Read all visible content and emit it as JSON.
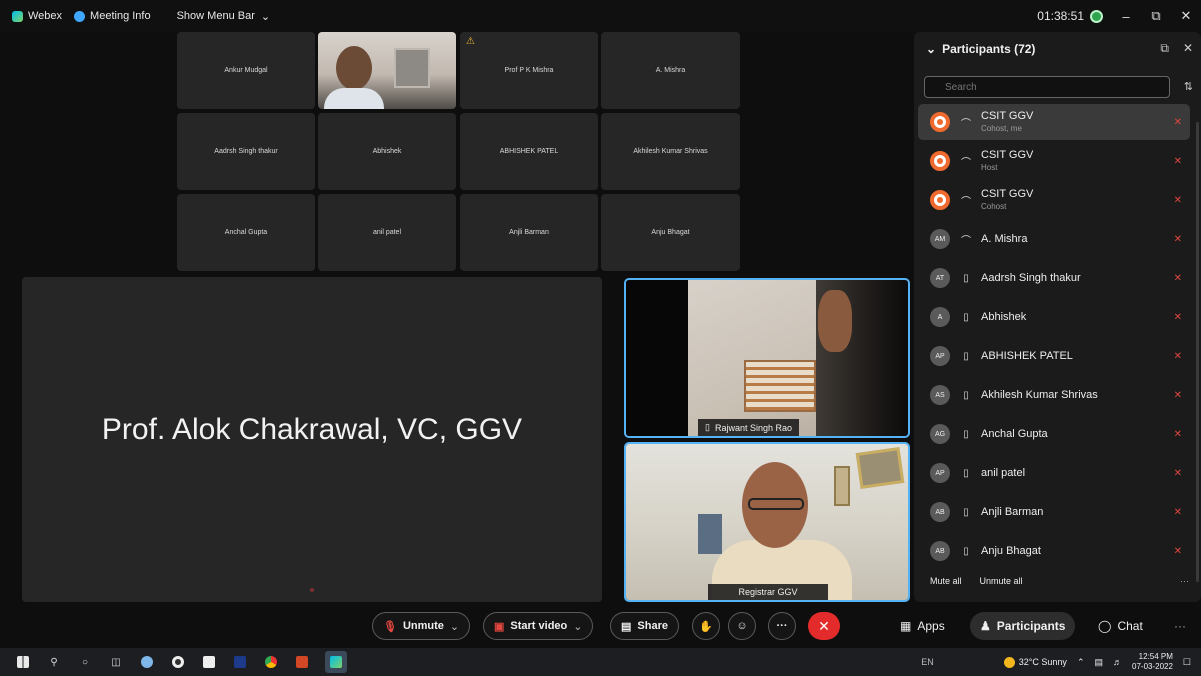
{
  "topbar": {
    "app_name": "Webex",
    "meeting_info": "Meeting Info",
    "show_menu_bar": "Show Menu Bar",
    "timer": "01:38:51"
  },
  "grid_tiles": [
    {
      "label": "Ankur Mudgal"
    },
    {
      "label": ""
    },
    {
      "label": "Prof P K Mishra"
    },
    {
      "label": "A. Mishra"
    },
    {
      "label": "Aadrsh Singh thakur"
    },
    {
      "label": "Abhishek"
    },
    {
      "label": "ABHISHEK PATEL"
    },
    {
      "label": "Akhilesh Kumar Shrivas"
    },
    {
      "label": "Anchal Gupta"
    },
    {
      "label": "anil patel"
    },
    {
      "label": "Anjli Barman"
    },
    {
      "label": "Anju Bhagat"
    }
  ],
  "stage": {
    "name": "Prof. Alok Chakrawal, VC, GGV"
  },
  "videos": [
    {
      "label": "Rajwant Singh Rao"
    },
    {
      "label": "Registrar GGV"
    }
  ],
  "participants": {
    "title": "Participants (72)",
    "search_placeholder": "Search",
    "list": [
      {
        "initials": "",
        "name": "CSIT GGV",
        "role": "Cohost, me",
        "device": "headset-icon"
      },
      {
        "initials": "",
        "name": "CSIT GGV",
        "role": "Host",
        "device": "headset-icon"
      },
      {
        "initials": "",
        "name": "CSIT GGV",
        "role": "Cohost",
        "device": "headset-icon"
      },
      {
        "initials": "AM",
        "name": "A. Mishra",
        "role": "",
        "device": "headset-icon"
      },
      {
        "initials": "AT",
        "name": "Aadrsh Singh thakur",
        "role": "",
        "device": "phone-icon"
      },
      {
        "initials": "A",
        "name": "Abhishek",
        "role": "",
        "device": "phone-icon"
      },
      {
        "initials": "AP",
        "name": "ABHISHEK PATEL",
        "role": "",
        "device": "phone-icon"
      },
      {
        "initials": "AS",
        "name": "Akhilesh Kumar Shrivas",
        "role": "",
        "device": "phone-icon"
      },
      {
        "initials": "AG",
        "name": "Anchal Gupta",
        "role": "",
        "device": "phone-icon"
      },
      {
        "initials": "AP",
        "name": "anil patel",
        "role": "",
        "device": "phone-icon"
      },
      {
        "initials": "AB",
        "name": "Anjli Barman",
        "role": "",
        "device": "phone-icon"
      },
      {
        "initials": "AB",
        "name": "Anju Bhagat",
        "role": "",
        "device": "phone-icon"
      }
    ],
    "mute_all": "Mute all",
    "unmute_all": "Unmute all"
  },
  "controls": {
    "unmute": "Unmute",
    "start_video": "Start video",
    "share": "Share",
    "apps": "Apps",
    "participants": "Participants",
    "chat": "Chat"
  },
  "taskbar": {
    "lang": "EN",
    "weather": "32°C Sunny",
    "time": "12:54 PM",
    "date": "07-03-2022"
  },
  "colors": {
    "accent_border": "#55b3f5",
    "end_call": "#e42b2b",
    "muted": "#e0473e",
    "host_avatar": "#ee6a2f"
  }
}
